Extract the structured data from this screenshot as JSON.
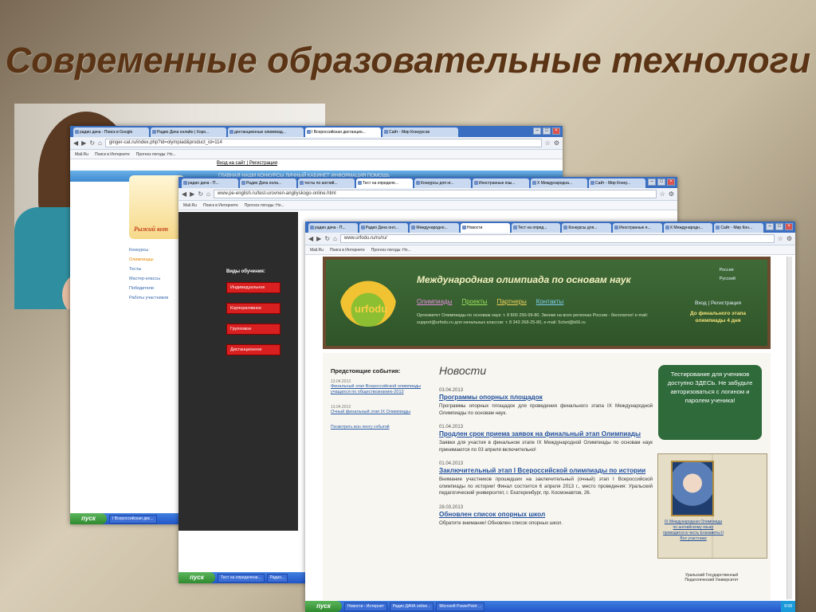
{
  "slide": {
    "title": "Современные образовательные технологи"
  },
  "win1": {
    "tabs": [
      "радио дача - Поиск в Google",
      "Радио Дача онлайн | Хоро...",
      "дистанционные олимпиад...",
      "I Всероссийская дистанцио...",
      "Сайт - Мир Конкурсов"
    ],
    "url": "ginger-cat.ru/index.php?id=olympiad&product_id=114",
    "bookmarks": [
      "Mail.Ru",
      "Поиск в Интернете",
      "Прогноз погоды: Но..."
    ],
    "login": "Вход на сайт | Регистрация",
    "menu": "ГЛАВНАЯ   НАШИ КОНКУРСЫ   ЛИЧНЫЙ КАБИНЕТ   ИНФОРМАЦИЯ   ПОМОЩЬ",
    "logo": "Рыжий кот",
    "side": [
      "Конкурсы",
      "Олимпиады",
      "Тесты",
      "Мастер-классы",
      "Победители",
      "Работы участников"
    ],
    "taskbar": {
      "start": "пуск",
      "btn": "I Всероссийская дис..."
    }
  },
  "win2": {
    "tabs": [
      "радио дача - П...",
      "Радио Дача онла...",
      "тесты по англий...",
      "Тест на определе...",
      "Конкурсы для нг...",
      "Иностранные язы...",
      "X Международна...",
      "Сайт - Мир Конку..."
    ],
    "url": "www.pe-english.ru/test-urovnen-angliyskogo-online.html",
    "bookmarks": [
      "Mail.Ru",
      "Поиск в Интернете",
      "Прогноз погоды: Но..."
    ],
    "label": "Виды обучения:",
    "buttons": [
      "Индивидуальное",
      "Корпоративное",
      "Групповое",
      "Дистанционное"
    ],
    "taskbar": {
      "start": "пуск",
      "btn1": "Тест на определени...",
      "btn2": "Радио..."
    }
  },
  "win3": {
    "tabs": [
      "радио дача - П...",
      "Радио Дача онл...",
      "Международно...",
      "Новости",
      "Тест на опред...",
      "Конкурсы для...",
      "Иностранные я...",
      "X Международн...",
      "Сайт - Мир Кон..."
    ],
    "url": "www.urfodu.ru/ru/ru/",
    "bookmarks": [
      "Mail.Ru",
      "Поиск в Интернете",
      "Прогноз погоды: Но..."
    ],
    "logo": "urfodu",
    "header_title": "Международная олимпиада по основам наук",
    "menu": [
      "Олимпиады",
      "Проекты",
      "Партнеры",
      "Контакты"
    ],
    "info": "Оргкомитет Олимпиады по основам наук: т. 8 800 250-99-80. Звонки на всех регионах России - бесплатно! e-mail: support@urfodu.ru для начальных классов: т. 8 343 268-25-80, e-mail: 5chet@k66.ru",
    "lang1": "Россия",
    "lang2": "Русский",
    "auth": "Вход | Регистрация",
    "final": "До финального этапа олимпиады 4 дня",
    "events_title": "Предстоящие события:",
    "events": [
      {
        "date": "13.04.2013",
        "title": "Финальный этап Всероссийской олимпиады учащихся по обществознанию-2013"
      },
      {
        "date": "13.04.2013",
        "title": "Очный финальный этап IX Олимпиады"
      }
    ],
    "events_all": "Посмотреть всю ленту событий",
    "news_title": "Новости",
    "news": [
      {
        "date": "03.04.2013",
        "title": "Программы опорных площадок",
        "body": "Программы опорных площадок для проведения финального этапа IX Международной Олимпиады по основам наук."
      },
      {
        "date": "01.04.2013",
        "title": "Продлен срок приема заявок на финальный этап Олимпиады",
        "body": "Заявки для участия в финальном этапе IX Международной Олимпиады по основам наук принимаются по 03 апреля включительно!"
      },
      {
        "date": "01.04.2013",
        "title": "Заключительный этап I Всероссийской олимпиады по истории",
        "body": "Внимание участников прошедших на заключительный (очный) этап I Всероссийской олимпиады по истории! Финал состоится 6 апреля 2013 г., место проведения: Уральский педагогический университет, г. Екатеринбург, пр. Космонавтов, 26."
      },
      {
        "date": "28.03.2013",
        "title": "Обновлен список опорных школ",
        "body": "Обратите внимание! Обновлен список опорных школ."
      }
    ],
    "greenbox": "Тестирование для учеников доступно ЗДЕСЬ. Не забудьте авторизоваться с логином и паролем ученика!",
    "book_text": "IX Международная Олимпиада по английскому языку проводится в честь Елизаветы II Все участники",
    "uni": "Уральский Государственный Педагогический Университет",
    "taskbar": {
      "start": "пуск",
      "btn1": "Новости - Интернет",
      "btn2": "Радио ДАЧА online...",
      "btn3": "Microsoft PowerPoint ...",
      "time": "8:58"
    }
  }
}
